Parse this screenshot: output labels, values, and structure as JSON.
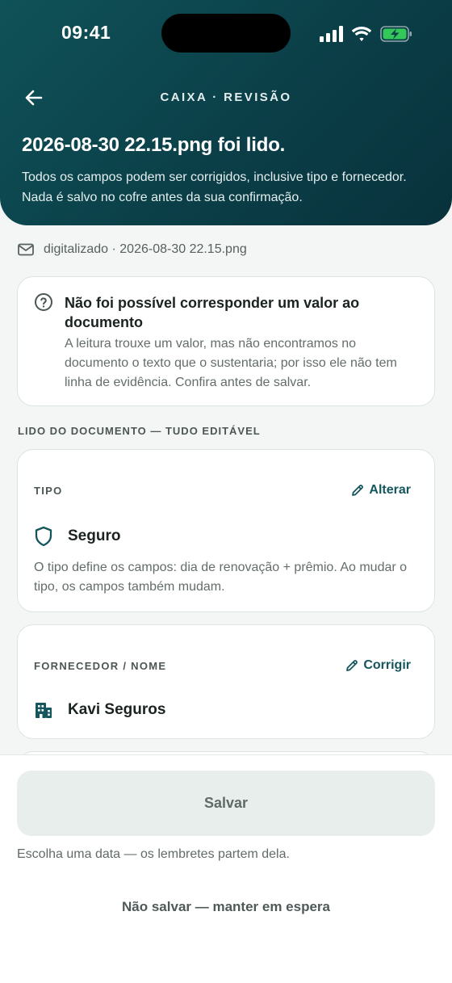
{
  "status_bar": {
    "time": "09:41",
    "icons": [
      "signal-icon",
      "wifi-icon",
      "battery-charging-icon"
    ],
    "battery_color": "#34c759"
  },
  "header": {
    "back_icon": "arrow-left-icon",
    "nav_title": "CAIXA · REVISÃO",
    "headline": "2026-08-30 22.15.png foi lido.",
    "subtext": "Todos os campos podem ser corrigidos, inclusive tipo e fornecedor. Nada é salvo no cofre antes da sua confirmação.",
    "gradient_colors": [
      "#0f5258",
      "#08323c"
    ]
  },
  "source": {
    "icon": "mail-icon",
    "text": "digitalizado · 2026-08-30 22.15.png"
  },
  "alert": {
    "icon": "question-circle-icon",
    "title": "Não foi possível corresponder um valor ao documento",
    "body": "A leitura trouxe um valor, mas não encontramos no documento o texto que o sustentaria; por isso ele não tem linha de evidência. Confira antes de salvar."
  },
  "section_label": "LIDO DO DOCUMENTO — TUDO EDITÁVEL",
  "fields": {
    "type": {
      "label": "TIPO",
      "action": "Alterar",
      "action_icon": "pencil-icon",
      "value": "Seguro",
      "value_icon": "shield-icon",
      "hint": "O tipo define os campos: dia de renovação + prêmio. Ao mudar o tipo, os campos também mudam."
    },
    "vendor": {
      "label": "FORNECEDOR / NOME",
      "action": "Corrigir",
      "action_icon": "pencil-icon",
      "value": "Kavi Seguros",
      "value_icon": "building-icon"
    }
  },
  "footer": {
    "save_label": "Salvar",
    "helper": "Escolha uma data — os lembretes partem dela.",
    "hold_label": "Não salvar — manter em espera"
  },
  "colors": {
    "accent": "#15555c",
    "background": "#f3f6f5",
    "disabled_button": "#e8eeeb"
  }
}
